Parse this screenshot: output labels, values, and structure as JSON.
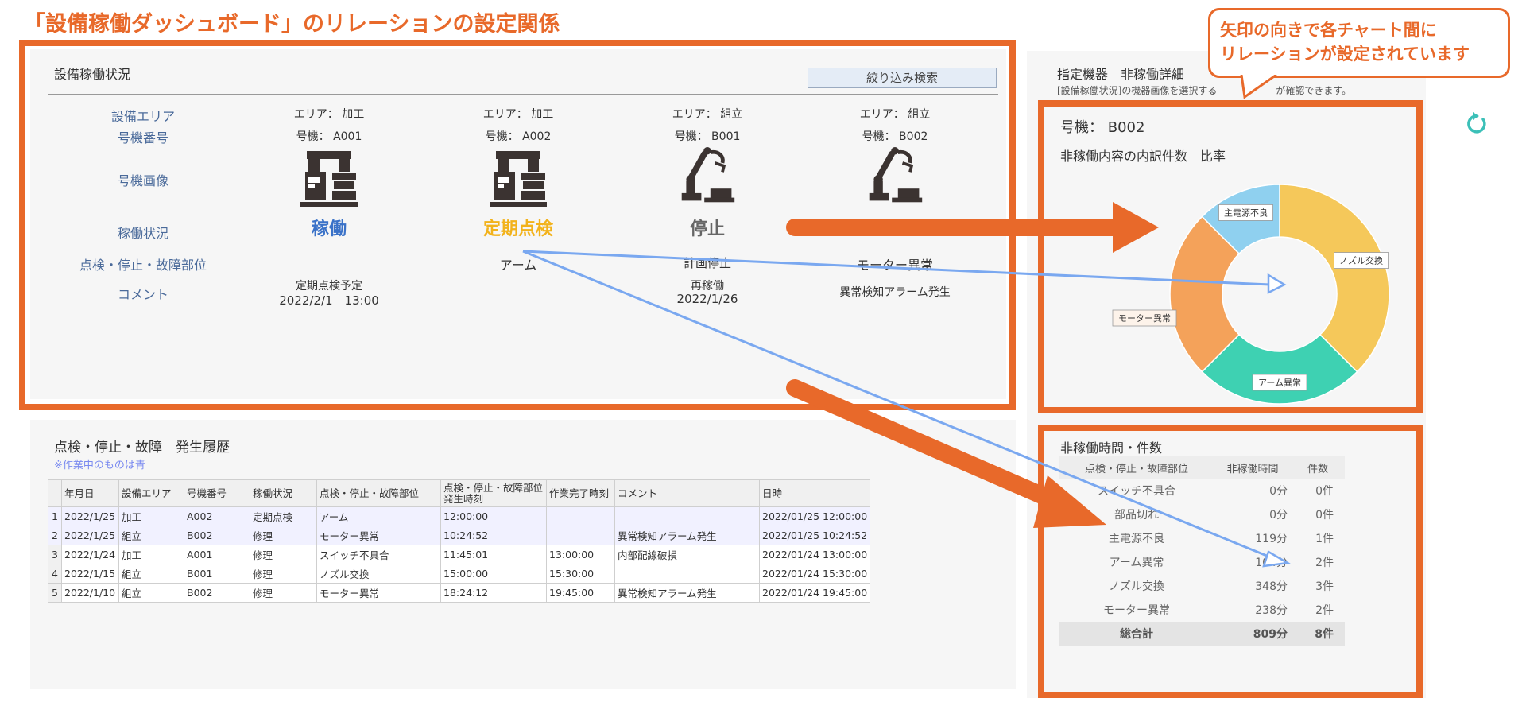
{
  "page_title": "「設備稼働ダッシュボード」のリレーションの設定関係",
  "callout": {
    "line1": "矢印の向きで各チャート間に",
    "line2": "リレーションが設定されています"
  },
  "status_panel": {
    "heading": "設備稼働状況",
    "filter_button": "絞り込み検索",
    "row_labels": [
      "設備エリア",
      "号機番号",
      "号機画像",
      "稼働状況",
      "点検・停止・故障部位",
      "コメント"
    ],
    "machines": [
      {
        "area": "エリア： 加工",
        "number": "号機： A001",
        "icon": "press-machine-icon",
        "status": "稼働",
        "status_color": "#3a72c8",
        "part": "",
        "comment1": "定期点検予定",
        "comment2": "2022/2/1　13:00"
      },
      {
        "area": "エリア： 加工",
        "number": "号機： A002",
        "icon": "press-machine-icon",
        "status": "定期点検",
        "status_color": "#f2b21b",
        "part": "アーム",
        "comment1": "",
        "comment2": ""
      },
      {
        "area": "エリア： 組立",
        "number": "号機： B001",
        "icon": "robot-arm-icon",
        "status": "停止",
        "status_color": "#666666",
        "part": "計画停止",
        "comment1": "再稼働",
        "comment2": "2022/1/26"
      },
      {
        "area": "エリア： 組立",
        "number": "号機： B002",
        "icon": "robot-arm-icon",
        "status": "",
        "status_color": "#666666",
        "part": "モーター異常",
        "comment1": "異常検知アラーム発生",
        "comment2": ""
      }
    ]
  },
  "history": {
    "title": "点検・停止・故障　発生履歴",
    "note": "※作業中のものは青",
    "headers": [
      "",
      "年月日",
      "設備エリア",
      "号機番号",
      "稼働状況",
      "点検・停止・故障部位",
      "点検・停止・故障部位\n発生時刻",
      "作業完了時刻",
      "コメント",
      "日時"
    ],
    "rows": [
      {
        "no": "1",
        "date": "2022/1/25",
        "area": "加工",
        "machine": "A002",
        "status": "定期点検",
        "part": "アーム",
        "time": "12:00:00",
        "done": "",
        "comment": "",
        "datetime": "2022/01/25 12:00:00",
        "active": true
      },
      {
        "no": "2",
        "date": "2022/1/25",
        "area": "組立",
        "machine": "B002",
        "status": "修理",
        "part": "モーター異常",
        "time": "10:24:52",
        "done": "",
        "comment": "異常検知アラーム発生",
        "datetime": "2022/01/25 10:24:52",
        "active": true
      },
      {
        "no": "3",
        "date": "2022/1/24",
        "area": "加工",
        "machine": "A001",
        "status": "修理",
        "part": "スイッチ不具合",
        "time": "11:45:01",
        "done": "13:00:00",
        "comment": "内部配線破損",
        "datetime": "2022/01/24 13:00:00",
        "active": false
      },
      {
        "no": "4",
        "date": "2022/1/15",
        "area": "組立",
        "machine": "B001",
        "status": "修理",
        "part": "ノズル交換",
        "time": "15:00:00",
        "done": "15:30:00",
        "comment": "",
        "datetime": "2022/01/24 15:30:00",
        "active": false
      },
      {
        "no": "5",
        "date": "2022/1/10",
        "area": "組立",
        "machine": "B002",
        "status": "修理",
        "part": "モーター異常",
        "time": "18:24:12",
        "done": "19:45:00",
        "comment": "異常検知アラーム発生",
        "datetime": "2022/01/24 19:45:00",
        "active": false
      }
    ]
  },
  "detail": {
    "title": "指定機器　非稼働詳細",
    "description": "[設備稼働状況]の機器画像を選択する",
    "description_end": "が確認できます。",
    "machine_label": "号機： B002",
    "chart_title": "非稼働内容の内訳件数　比率",
    "refresh_icon": "refresh-icon"
  },
  "chart_data": {
    "type": "pie",
    "donut": true,
    "title": "非稼働内容の内訳件数　比率",
    "series": [
      {
        "name": "ノズル交換",
        "value": 3,
        "color": "#f5c85a"
      },
      {
        "name": "アーム異常",
        "value": 2,
        "color": "#3ed1b2"
      },
      {
        "name": "モーター異常",
        "value": 2,
        "color": "#f4a25a"
      },
      {
        "name": "主電源不良",
        "value": 1,
        "color": "#8fd0ef"
      }
    ]
  },
  "time_table": {
    "title": "非稼働時間・件数",
    "headers": [
      "点検・停止・故障部位",
      "非稼働時間",
      "件数"
    ],
    "rows": [
      {
        "part": "スイッチ不具合",
        "minutes": "0分",
        "count": "0件"
      },
      {
        "part": "部品切れ",
        "minutes": "0分",
        "count": "0件"
      },
      {
        "part": "主電源不良",
        "minutes": "119分",
        "count": "1件"
      },
      {
        "part": "アーム異常",
        "minutes": "104分",
        "count": "2件"
      },
      {
        "part": "ノズル交換",
        "minutes": "348分",
        "count": "3件"
      },
      {
        "part": "モーター異常",
        "minutes": "238分",
        "count": "2件"
      }
    ],
    "total": {
      "part": "総合計",
      "minutes": "809分",
      "count": "8件"
    }
  },
  "colors": {
    "accent_orange": "#e8692a",
    "relation_line": "#7aa8f0"
  }
}
